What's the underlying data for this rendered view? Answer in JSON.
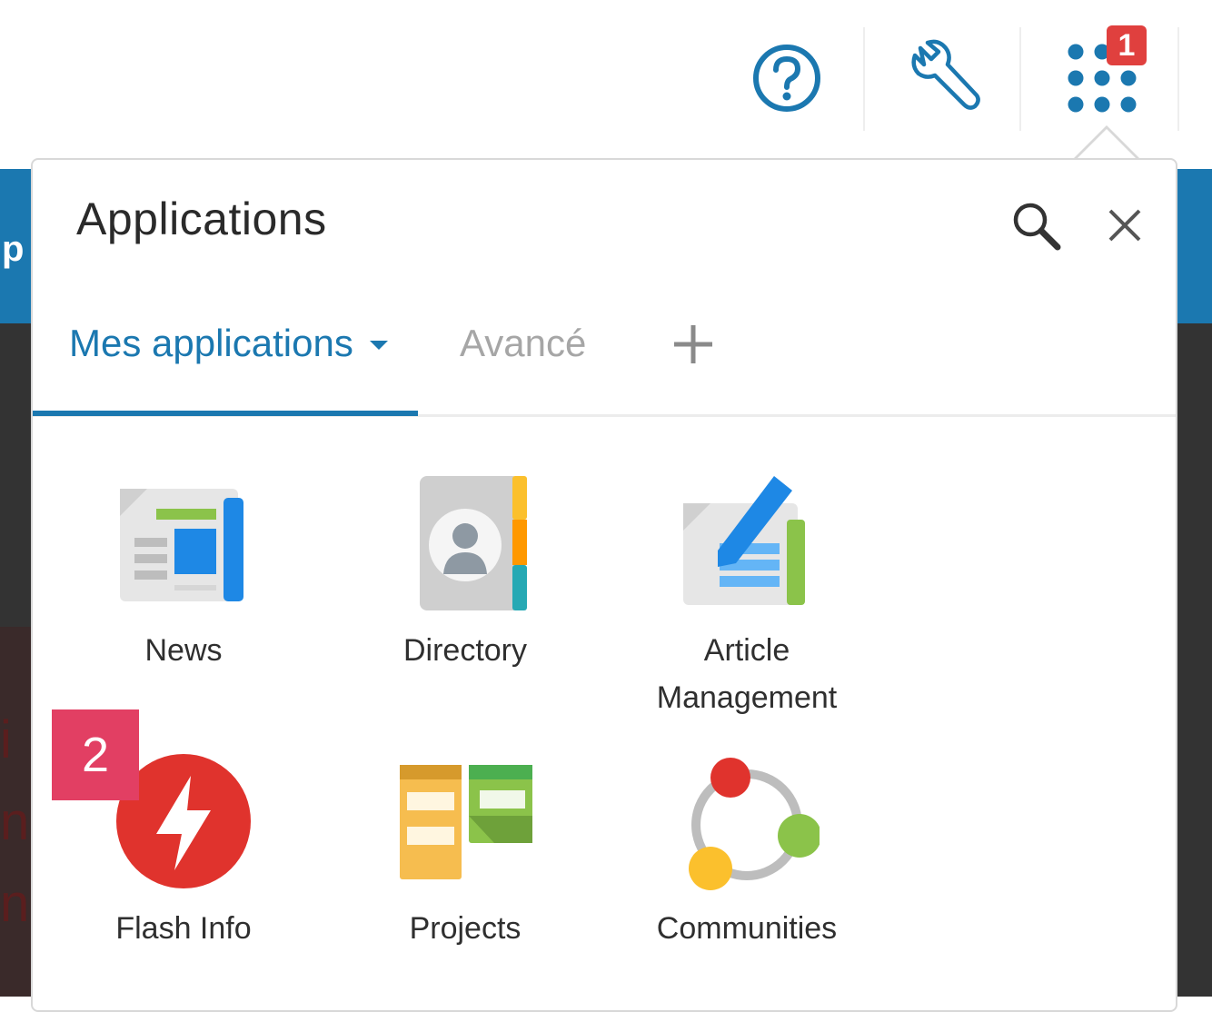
{
  "colors": {
    "accent": "#1b78b0",
    "badge": "#e0403e",
    "step_badge": "#e23f63",
    "inactive_tab": "#a6a6a6"
  },
  "background": {
    "band_letter": "p",
    "strip_text": [
      "i",
      "n",
      "n"
    ]
  },
  "topbar": {
    "icons": [
      "help-icon",
      "wrench-icon",
      "app-grid-icon"
    ],
    "notification_count": "1"
  },
  "popover": {
    "title": "Applications",
    "search_icon": "search-icon",
    "close_icon": "close-icon",
    "tabs": [
      {
        "label": "Mes applications",
        "active": true,
        "dropdown": true
      },
      {
        "label": "Avancé",
        "active": false
      }
    ],
    "add_tab_icon": "plus-icon",
    "apps": [
      {
        "label": "News",
        "icon": "news-icon"
      },
      {
        "label": "Directory",
        "icon": "directory-icon"
      },
      {
        "label": "Article\nManagement",
        "icon": "article-management-icon"
      },
      {
        "label": "Flash Info",
        "icon": "flash-info-icon"
      },
      {
        "label": "Projects",
        "icon": "projects-icon"
      },
      {
        "label": "Communities",
        "icon": "communities-icon"
      }
    ]
  },
  "step_badge": "2"
}
